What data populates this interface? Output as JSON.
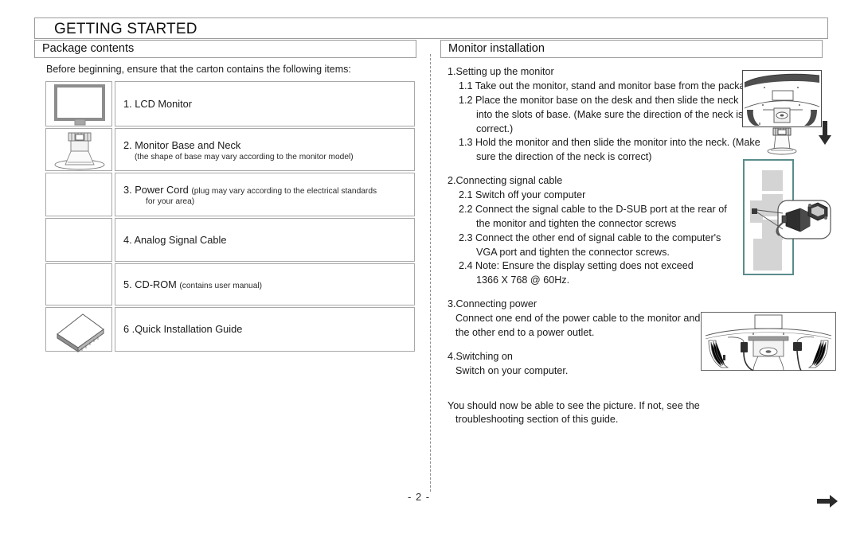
{
  "page": {
    "title": "GETTING STARTED",
    "number": "- 2 -"
  },
  "sections": {
    "package": {
      "header": "Package contents",
      "intro": "Before beginning, ensure that the carton contains the following items:"
    },
    "monitor": {
      "header": "Monitor installation"
    }
  },
  "package_items": [
    {
      "icon": "lcd-monitor-icon",
      "label": "1. LCD Monitor",
      "note": "",
      "note_style": "none"
    },
    {
      "icon": "monitor-base-neck-icon",
      "label": "2. Monitor Base and Neck",
      "note": "(the shape of base may vary according to the monitor model)",
      "note_style": "block"
    },
    {
      "icon": "",
      "label": "3. Power Cord ",
      "note": "(plug may vary according to the electrical standards",
      "note2": "for your area)",
      "note_style": "inline-wrap"
    },
    {
      "icon": "",
      "label": "4. Analog Signal Cable",
      "note": "",
      "note_style": "none"
    },
    {
      "icon": "",
      "label": "5. CD-ROM ",
      "note": "(contains user manual)",
      "note_style": "inline"
    },
    {
      "icon": "quick-install-guide-icon",
      "label": "6 .Quick Installation Guide",
      "note": "",
      "note_style": "none"
    }
  ],
  "instructions": {
    "step1": {
      "head": "1.Setting up the monitor",
      "lines": [
        "1.1 Take out the monitor, stand and monitor base from the package.",
        "1.2 Place the monitor base on the desk and then slide the neck",
        "into the slots of base. (Make sure the direction of the neck is",
        "correct.)",
        "1.3 Hold the monitor and then slide the monitor into the neck. (Make",
        "sure the direction of the neck is correct)"
      ]
    },
    "step2": {
      "head": "2.Connecting signal cable",
      "lines": [
        "2.1 Switch off your computer",
        "2.2 Connect the signal cable to the D-SUB port at the rear of",
        "the monitor and tighten the connector screws",
        "2.3 Connect the other end of signal cable to the computer's",
        "VGA port and tighten the connector screws.",
        "2.4 Note: Ensure the display setting does not exceed",
        "1366 X 768 @ 60Hz."
      ]
    },
    "step3": {
      "head": "3.Connecting power",
      "lines": [
        "Connect one end of the power cable to the monitor and",
        "the other end to a power outlet."
      ]
    },
    "step4": {
      "head": "4.Switching on",
      "lines": [
        "Switch on your computer."
      ]
    },
    "closing": {
      "line1": "You should now be able to see the picture. If not, see the",
      "line2": "troubleshooting section of this guide."
    }
  },
  "figures": {
    "monitor_back": "monitor-rear-view-figure",
    "neck_small": "monitor-neck-figure",
    "down_arrow": "down-arrow-icon",
    "pc_cable": "pc-vga-cable-connection-figure",
    "power_back": "monitor-rear-power-connection-figure",
    "next_arrow": "next-page-arrow-icon"
  },
  "colors": {
    "border": "#9a9a9a",
    "text": "#1a1a1a",
    "icon_gray": "#8a8a8a",
    "teal_frame": "#5b8c8c"
  }
}
